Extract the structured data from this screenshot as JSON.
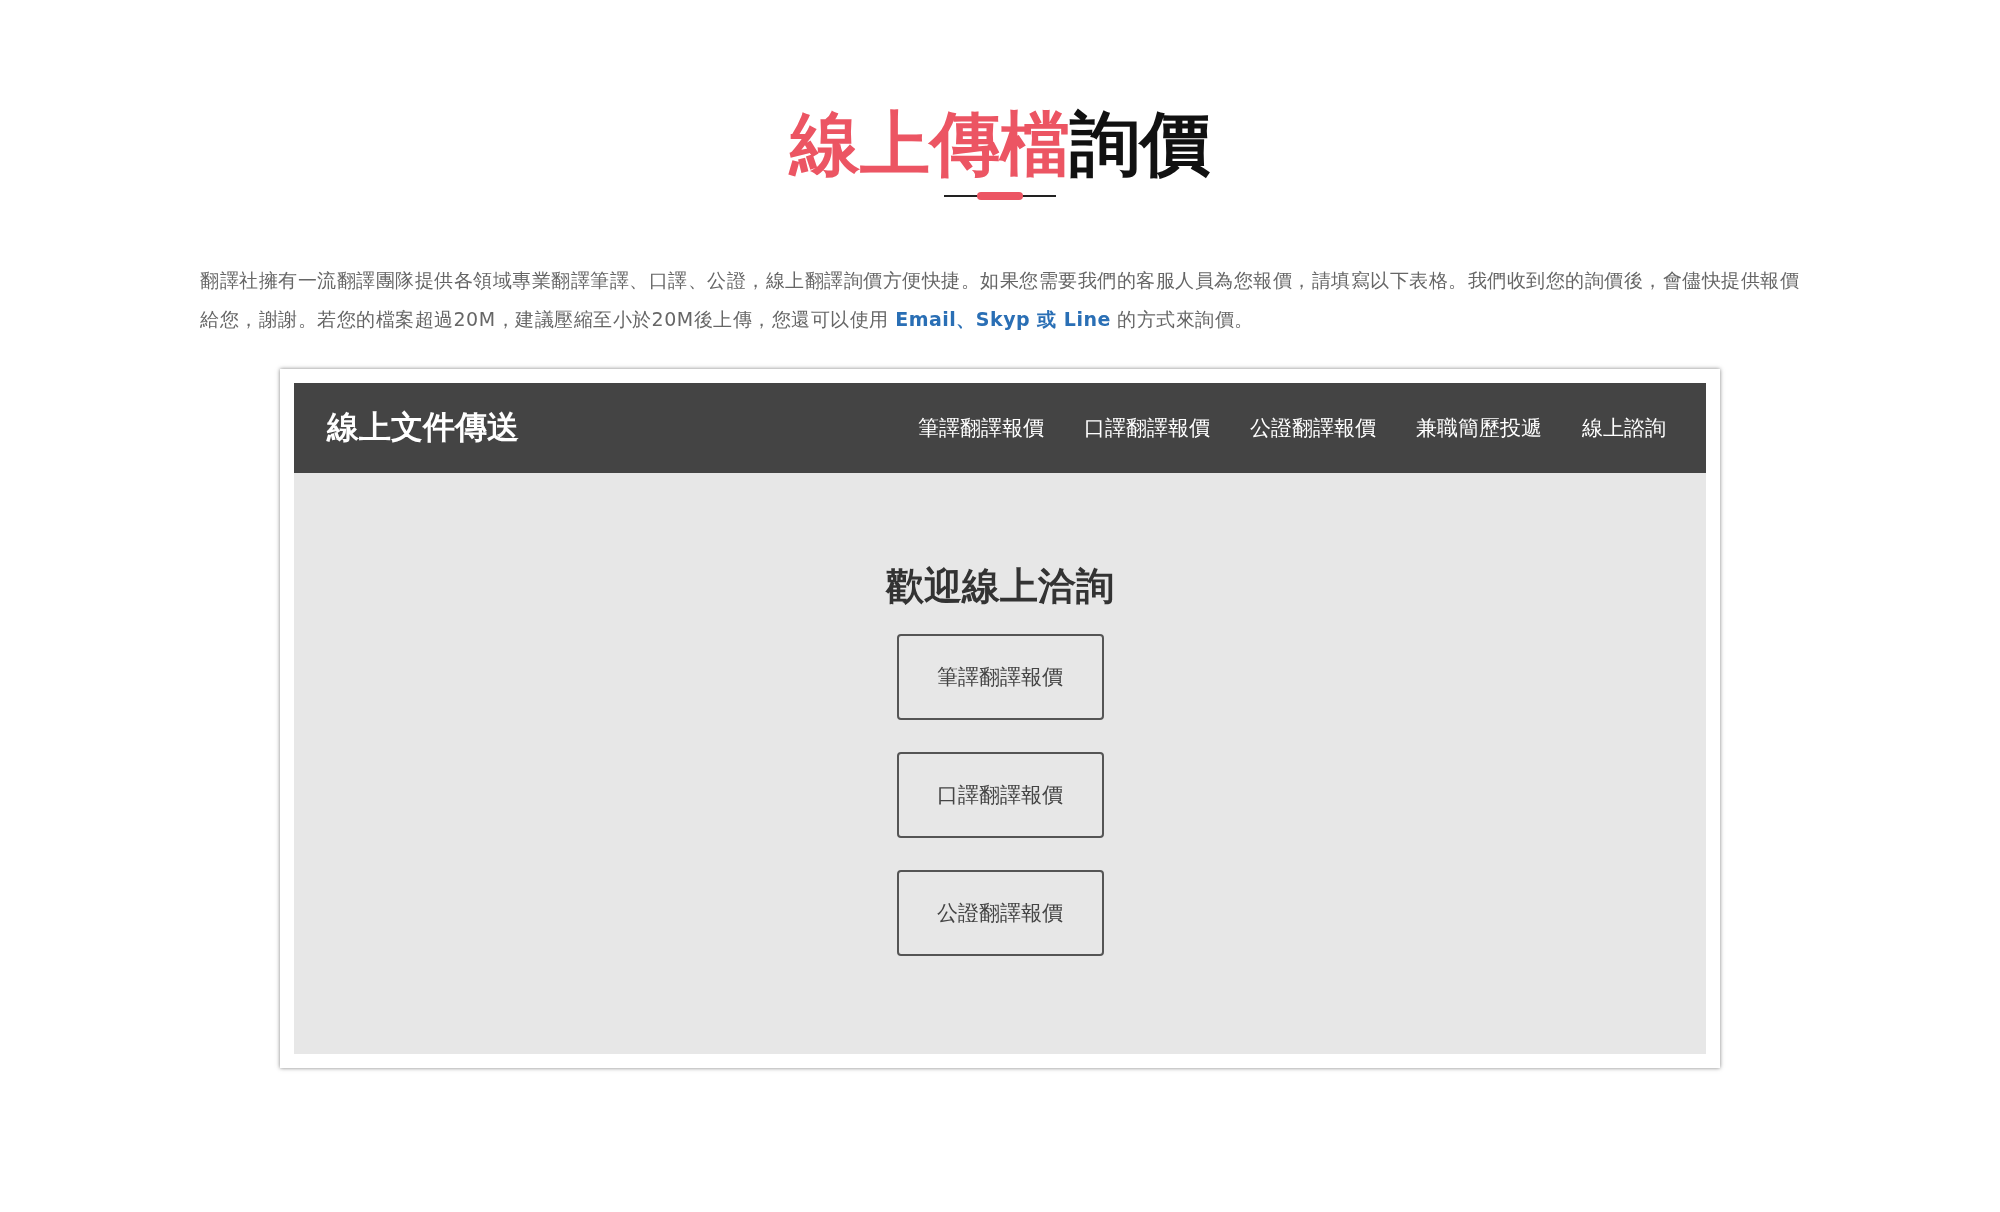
{
  "heading": {
    "highlight": "線上傳檔",
    "rest": "詢價"
  },
  "intro": "翻譯社擁有一流翻譯團隊提供各領域專業翻譯筆譯、口譯、公證，線上翻譯詢價方便快捷。如果您需要我們的客服人員為您報價，請填寫以下表格。我們收到您的詢價後，會儘快提供報價給您，謝謝。若您的檔案超過20M，建議壓縮至小於20M後上傳，您還可以使用 **Email、Skyp 或 Line** 的方式來詢價。",
  "panel": {
    "brand": "線上文件傳送",
    "nav": [
      "筆譯翻譯報價",
      "口譯翻譯報價",
      "公證翻譯報價",
      "兼職簡歷投遞",
      "線上諮詢"
    ],
    "welcome": "歡迎線上洽詢",
    "buttons": [
      "筆譯翻譯報價",
      "口譯翻譯報價",
      "公證翻譯報價"
    ]
  }
}
